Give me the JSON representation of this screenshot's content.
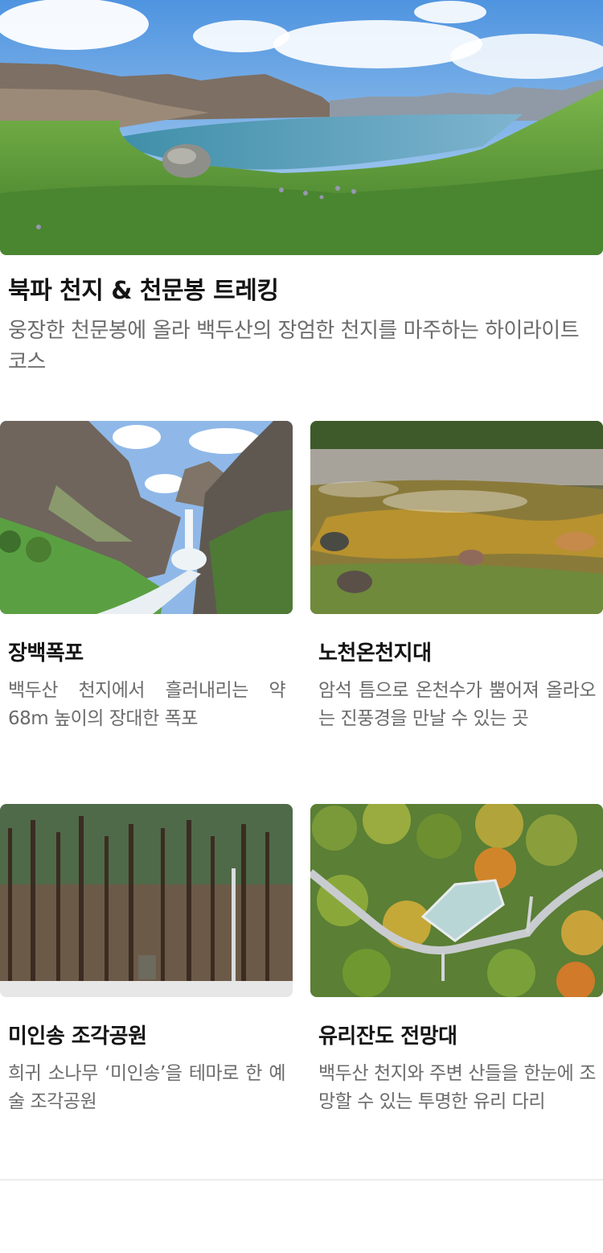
{
  "hero": {
    "title": "북파 천지 & 천문봉 트레킹",
    "description": "웅장한 천문봉에 올라 백두산의 장엄한 천지를 마주하는 하이라이트 코스",
    "image": "lake-mountain-landscape"
  },
  "cards": [
    {
      "title": "장백폭포",
      "description": "백두산 천지에서 흘러내리는 약 68m 높이의 장대한 폭포",
      "image": "waterfall-photo"
    },
    {
      "title": "노천온천지대",
      "description": "암석 틈으로 온천수가 뿜어져 올라오는 진풍경을 만날 수 있는 곳",
      "image": "hot-spring-photo"
    },
    {
      "title": "미인송 조각공원",
      "description": "희귀 소나무 ‘미인송’을 테마로 한 예술 조각공원",
      "image": "pine-forest-photo"
    },
    {
      "title": "유리잔도 전망대",
      "description": "백두산 천지와 주변 산들을 한눈에 조망할 수 있는 투명한 유리 다리",
      "image": "glass-walkway-photo"
    }
  ],
  "colors": {
    "title": "#141414",
    "description": "#6b6b6b",
    "divider": "#ececec"
  }
}
